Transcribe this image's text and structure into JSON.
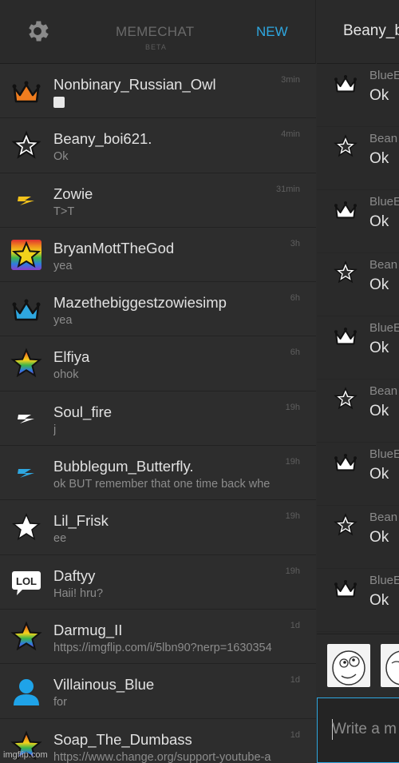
{
  "header": {
    "brand": "MEMECHAT",
    "beta": "BETA",
    "new_label": "NEW",
    "settings_icon": "gear-icon"
  },
  "conversations": [
    {
      "name": "Nonbinary_Russian_Owl",
      "preview": "",
      "time": "3min",
      "icon": "crown-orange-icon"
    },
    {
      "name": "Beany_boi621.",
      "preview": "Ok",
      "time": "4min",
      "icon": "star-outline-icon"
    },
    {
      "name": "Zowie",
      "preview": "T>T",
      "time": "31min",
      "icon": "bolt-yellow-icon"
    },
    {
      "name": "BryanMottTheGod",
      "preview": "yea",
      "time": "3h",
      "icon": "rainbow-star-badge-icon"
    },
    {
      "name": "Mazethebiggestzowiesimp",
      "preview": "yea",
      "time": "6h",
      "icon": "crown-blue-icon"
    },
    {
      "name": "Elfiya",
      "preview": "ohok",
      "time": "6h",
      "icon": "rainbow-star-icon"
    },
    {
      "name": "Soul_fire",
      "preview": "j",
      "time": "19h",
      "icon": "bolt-white-icon"
    },
    {
      "name": "Bubblegum_Butterfly.",
      "preview": "ok BUT remember that one time back whe",
      "time": "19h",
      "icon": "bolt-blue-icon"
    },
    {
      "name": "Lil_Frisk",
      "preview": "ee",
      "time": "19h",
      "icon": "star-white-icon"
    },
    {
      "name": "Daftyy",
      "preview": "Haii! hru?",
      "time": "19h",
      "icon": "lol-bubble-icon"
    },
    {
      "name": "Darmug_II",
      "preview": "https://imgflip.com/i/5lbn90?nerp=1630354",
      "time": "1d",
      "icon": "rainbow-star-icon"
    },
    {
      "name": "Villainous_Blue",
      "preview": "for",
      "time": "1d",
      "icon": "user-silhouette-icon"
    },
    {
      "name": "Soap_The_Dumbass",
      "preview": "https://www.change.org/support-youtube-a",
      "time": "1d",
      "icon": "rainbow-star-icon"
    }
  ],
  "chat": {
    "title": "Beany_b",
    "messages": [
      {
        "author": "BlueE",
        "text": "Ok",
        "icon": "crown-white-icon"
      },
      {
        "author": "Bean",
        "text": "Ok",
        "icon": "star-outline-icon"
      },
      {
        "author": "BlueE",
        "text": "Ok",
        "icon": "crown-white-icon"
      },
      {
        "author": "Bean",
        "text": "Ok",
        "icon": "star-outline-icon"
      },
      {
        "author": "BlueE",
        "text": "Ok",
        "icon": "crown-white-icon"
      },
      {
        "author": "Bean",
        "text": "Ok",
        "icon": "star-outline-icon"
      },
      {
        "author": "BlueE",
        "text": "Ok",
        "icon": "crown-white-icon"
      },
      {
        "author": "Bean",
        "text": "Ok",
        "icon": "star-outline-icon"
      },
      {
        "author": "BlueE",
        "text": "Ok",
        "icon": "crown-white-icon"
      }
    ],
    "composer_placeholder": "Write a m"
  },
  "watermark": "imgflip.com",
  "colors": {
    "accent": "#2ea7e0",
    "background": "#2d2d2d",
    "orange_crown": "#f07d1f",
    "blue_crown": "#2ea7e0",
    "yellow": "#f2c21b"
  }
}
